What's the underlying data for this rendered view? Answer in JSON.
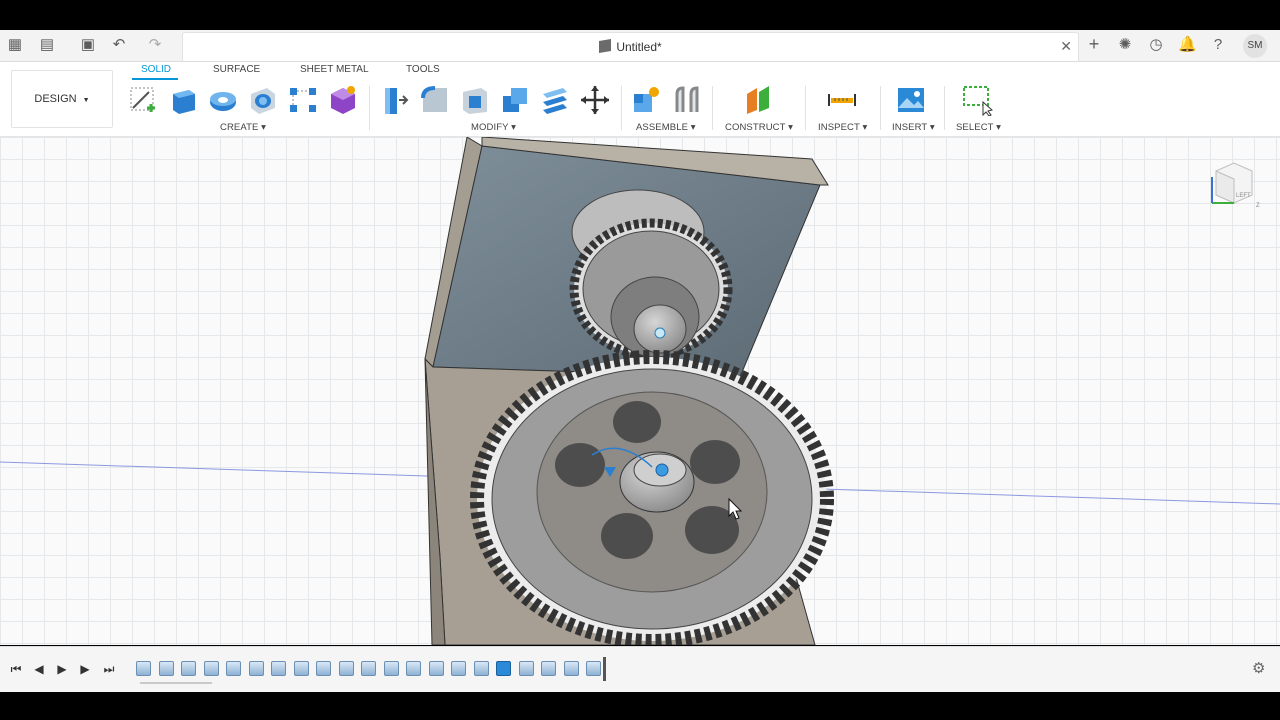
{
  "window": {
    "document_title": "Untitled*",
    "user_initials": "SM"
  },
  "workspace": {
    "label": "DESIGN"
  },
  "tabs": [
    {
      "label": "SOLID",
      "active": true
    },
    {
      "label": "SURFACE",
      "active": false
    },
    {
      "label": "SHEET METAL",
      "active": false
    },
    {
      "label": "TOOLS",
      "active": false
    }
  ],
  "groups": {
    "create": "CREATE",
    "modify": "MODIFY",
    "assemble": "ASSEMBLE",
    "construct": "CONSTRUCT",
    "inspect": "INSPECT",
    "insert": "INSERT",
    "select": "SELECT"
  },
  "viewcube": {
    "face_label": "LEFT"
  },
  "colors": {
    "accent": "#0696d7",
    "toolbar_bg": "#ffffff",
    "timeline_feature": "#8fb2d4"
  }
}
